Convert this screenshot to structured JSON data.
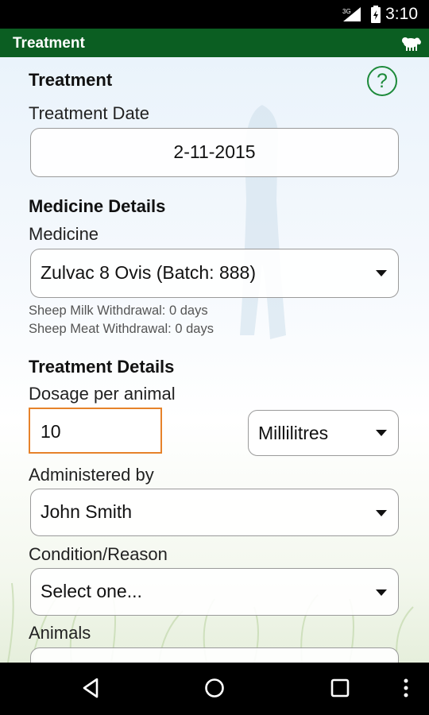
{
  "status_bar": {
    "network": "3G",
    "time": "3:10"
  },
  "app_bar": {
    "title": "Treatment",
    "icon": "sheep-icon"
  },
  "form": {
    "heading": "Treatment",
    "help_symbol": "?",
    "treatment_date_label": "Treatment Date",
    "treatment_date_value": "2-11-2015",
    "medicine_section": "Medicine Details",
    "medicine_label": "Medicine",
    "medicine_value": "Zulvac 8 Ovis (Batch: 888)",
    "milk_withdrawal": "Sheep Milk Withdrawal: 0 days",
    "meat_withdrawal": "Sheep Meat Withdrawal: 0 days",
    "treatment_section": "Treatment Details",
    "dosage_label": "Dosage per animal",
    "dosage_value": "10",
    "unit_value": "Millilitres",
    "administered_label": "Administered by",
    "administered_value": "John Smith",
    "reason_label": "Condition/Reason",
    "reason_value": "Select one...",
    "animals_label": "Animals"
  },
  "nav_bar": {
    "back": "back-icon",
    "home": "home-icon",
    "recents": "recents-icon",
    "menu": "overflow-menu-icon"
  },
  "colors": {
    "app_bar": "#0b5e22",
    "help": "#1d8a3a",
    "focus": "#e6822a"
  }
}
